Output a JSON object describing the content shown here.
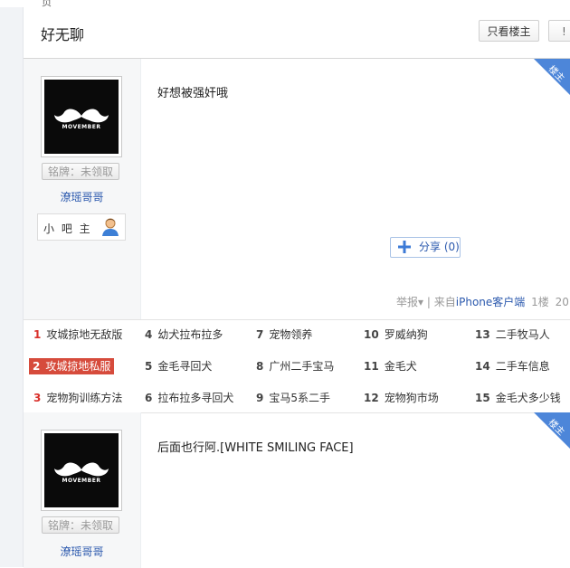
{
  "header": {
    "title": "好无聊",
    "only_op_label": "只看楼主",
    "next_label": "!"
  },
  "top_fragment": "页",
  "posts": [
    {
      "corner_tag": "楼主",
      "username": "潦瑶哥哥",
      "badge": "铭牌：未领取",
      "role": "小 吧 主",
      "content": "好想被强奸哦",
      "share_label": "分享",
      "share_count": "(0)",
      "report_label": "举报",
      "separator": "|",
      "source_prefix": "来自",
      "source_link": "iPhone客户端",
      "floor": "1楼",
      "time_fragment": "20",
      "avatar_text": "MOVEMBER"
    },
    {
      "corner_tag": "楼主",
      "username": "潦瑶哥哥",
      "badge": "铭牌：未领取",
      "content": "后面也行阿.[WHITE SMILING FACE]",
      "avatar_text": "MOVEMBER"
    }
  ],
  "hot_topics": [
    {
      "num": "1",
      "label": "攻城掠地无敌版"
    },
    {
      "num": "2",
      "label": "攻城掠地私服"
    },
    {
      "num": "3",
      "label": "宠物狗训练方法"
    },
    {
      "num": "4",
      "label": "幼犬拉布拉多"
    },
    {
      "num": "5",
      "label": "金毛寻回犬"
    },
    {
      "num": "6",
      "label": "拉布拉多寻回犬"
    },
    {
      "num": "7",
      "label": "宠物领养"
    },
    {
      "num": "8",
      "label": "广州二手宝马"
    },
    {
      "num": "9",
      "label": "宝马5系二手"
    },
    {
      "num": "10",
      "label": "罗威纳狗"
    },
    {
      "num": "11",
      "label": "金毛犬"
    },
    {
      "num": "12",
      "label": "宠物狗市场"
    },
    {
      "num": "13",
      "label": "二手牧马人"
    },
    {
      "num": "14",
      "label": "二手车信息"
    },
    {
      "num": "15",
      "label": "金毛犬多少钱"
    }
  ],
  "colors": {
    "link": "#2a58ad",
    "corner": "#4d86d9",
    "hot_active": "#d64b3c",
    "hot_rank": "#d9302a"
  }
}
